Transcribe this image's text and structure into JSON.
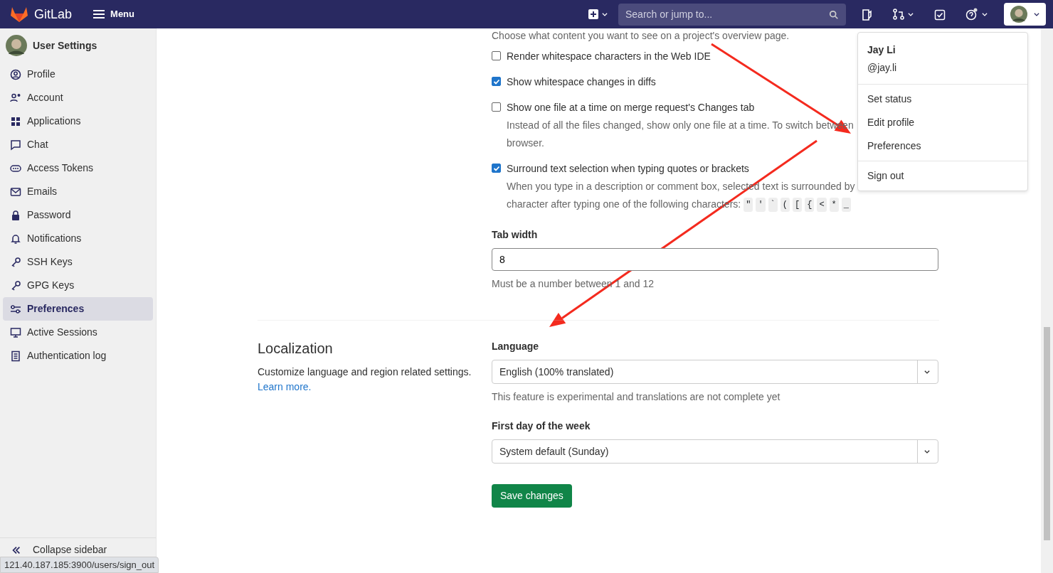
{
  "navbar": {
    "brand": "GitLab",
    "menu": "Menu",
    "search": {
      "placeholder": "Search or jump to..."
    }
  },
  "sidebar": {
    "title": "User Settings",
    "items": [
      {
        "label": "Profile",
        "selected": false
      },
      {
        "label": "Account",
        "selected": false
      },
      {
        "label": "Applications",
        "selected": false
      },
      {
        "label": "Chat",
        "selected": false
      },
      {
        "label": "Access Tokens",
        "selected": false
      },
      {
        "label": "Emails",
        "selected": false
      },
      {
        "label": "Password",
        "selected": false
      },
      {
        "label": "Notifications",
        "selected": false
      },
      {
        "label": "SSH Keys",
        "selected": false
      },
      {
        "label": "GPG Keys",
        "selected": false
      },
      {
        "label": "Preferences",
        "selected": true
      },
      {
        "label": "Active Sessions",
        "selected": false
      },
      {
        "label": "Authentication log",
        "selected": false
      }
    ],
    "collapse": "Collapse sidebar"
  },
  "behavior": {
    "intro": "Choose what content you want to see on a project's overview page.",
    "options": [
      {
        "label": "Render whitespace characters in the Web IDE",
        "checked": false
      },
      {
        "label": "Show whitespace changes in diffs",
        "checked": true
      },
      {
        "label": "Show one file at a time on merge request's Changes tab",
        "checked": false,
        "description": [
          "Instead of all the files changed, show only one file at a time. To switch between",
          "browser."
        ]
      },
      {
        "label": "Surround text selection when typing quotes or brackets",
        "checked": true,
        "description": [
          "When you type in a description or comment box, selected text is surrounded by",
          "character after typing one of the following characters:"
        ],
        "chars": [
          "\"",
          "'",
          "`",
          "(",
          "[",
          "{",
          "<",
          "*",
          "_"
        ]
      }
    ],
    "tab_width": {
      "label": "Tab width",
      "value": "8",
      "help": "Must be a number between 1 and 12"
    }
  },
  "localization": {
    "title": "Localization",
    "description": "Customize language and region related settings.",
    "link": "Learn more.",
    "fields": [
      {
        "label": "Language",
        "value": "English (100% translated)",
        "help": "This feature is experimental and translations are not complete yet"
      },
      {
        "label": "First day of the week",
        "value": "System default (Sunday)"
      }
    ],
    "save": "Save changes"
  },
  "user_menu": {
    "name": "Jay Li",
    "username": "@jay.li",
    "groups": [
      [
        "Set status",
        "Edit profile",
        "Preferences"
      ],
      [
        "Sign out"
      ]
    ]
  },
  "status_url": "121.40.187.185:3900/users/sign_out"
}
